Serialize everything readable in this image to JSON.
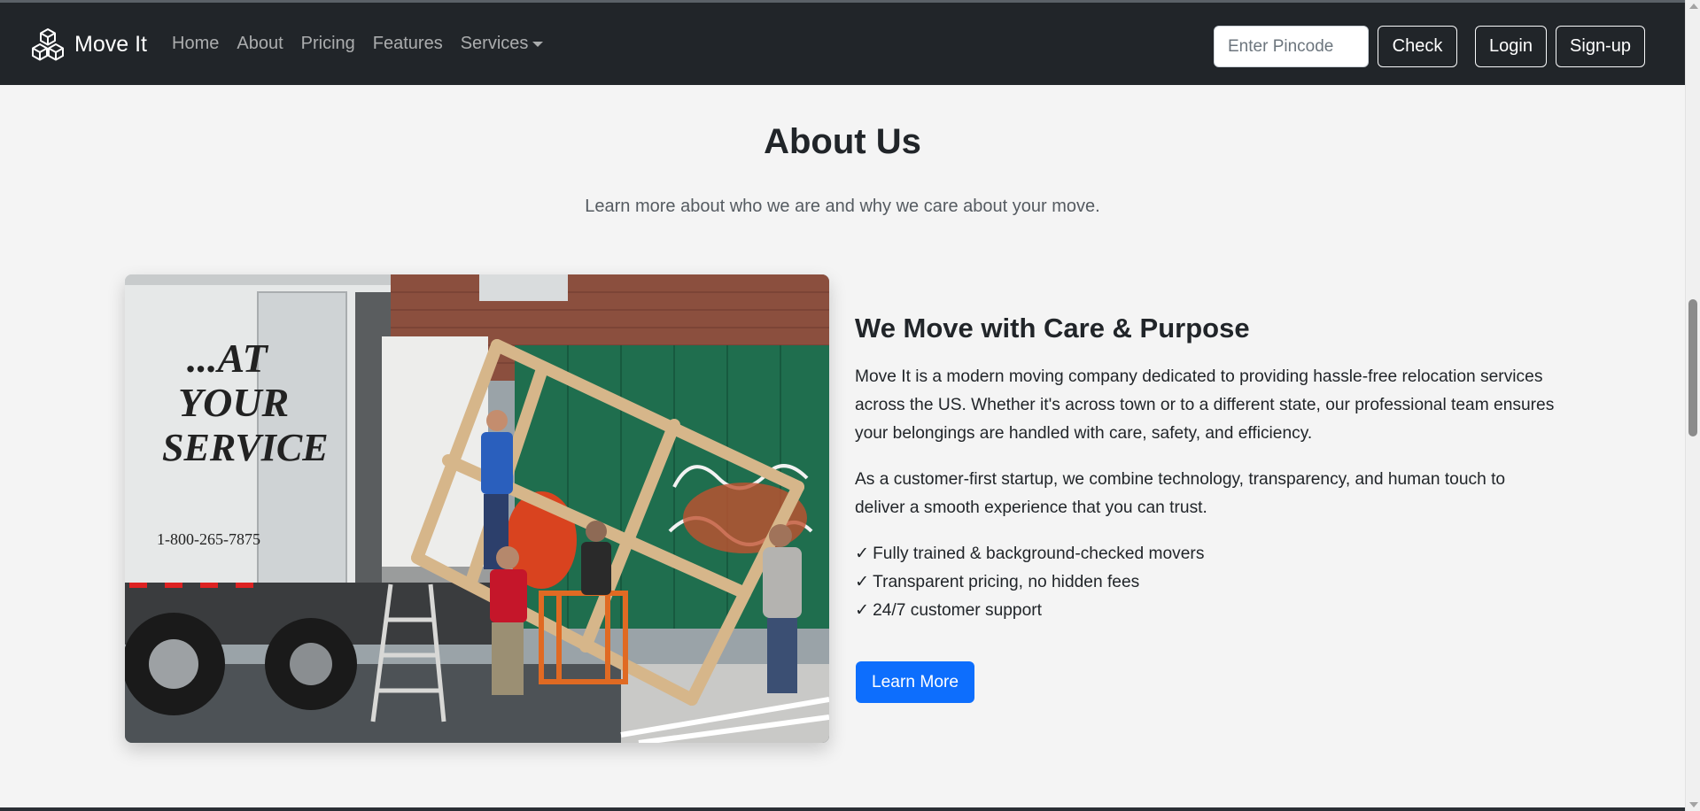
{
  "navbar": {
    "brand_name": "Move It",
    "brand_icon": "cubes-logo-icon",
    "links": [
      {
        "label": "Home"
      },
      {
        "label": "About"
      },
      {
        "label": "Pricing"
      },
      {
        "label": "Features"
      },
      {
        "label": "Services"
      }
    ],
    "pincode_placeholder": "Enter Pincode",
    "pincode_value": "",
    "check_label": "Check",
    "login_label": "Login",
    "signup_label": "Sign-up"
  },
  "about": {
    "title": "About Us",
    "subtitle": "Learn more about who we are and why we care about your move.",
    "content_title": "We Move with Care & Purpose",
    "paragraph1": "Move It is a modern moving company dedicated to providing hassle-free relocation services across the US. Whether it's across town or to a different state, our professional team ensures your belongings are handled with care, safety, and efficiency.",
    "paragraph2": "As a customer-first startup, we combine technology, transparency, and human touch to deliver a smooth experience that you can trust.",
    "features": [
      {
        "check": "✓",
        "text": "Fully trained & background-checked movers"
      },
      {
        "check": "✓",
        "text": "Transparent pricing, no hidden fees"
      },
      {
        "check": "✓",
        "text": "24/7 customer support"
      }
    ],
    "button_label": "Learn More",
    "photo": {
      "truck_text_1": "...AT",
      "truck_text_2": "YOUR",
      "truck_text_3": "SERVICE",
      "truck_phone": "1-800-265-7875"
    }
  },
  "colors": {
    "navbar_bg": "#212529",
    "page_bg": "#f4f4f4",
    "primary": "#0d6efd"
  }
}
